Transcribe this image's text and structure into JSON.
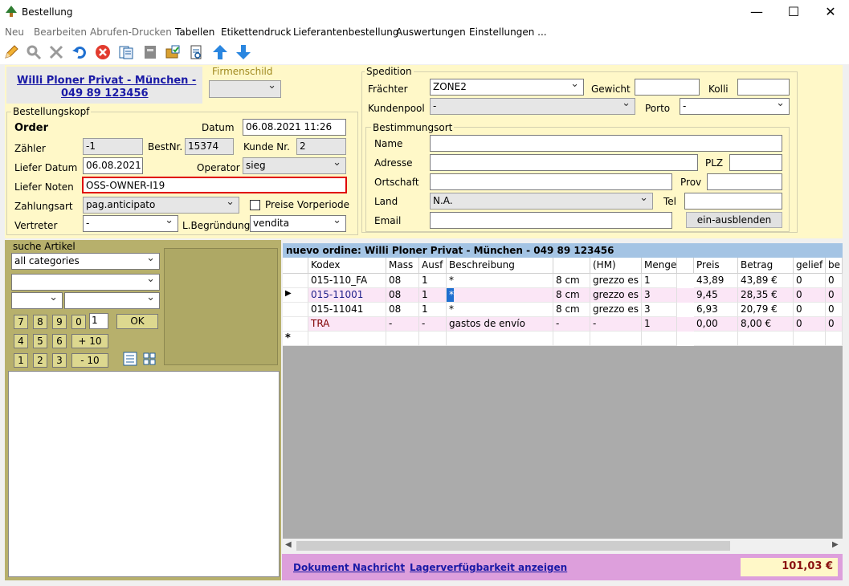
{
  "window": {
    "title": "Bestellung",
    "minimize": "—",
    "maximize": "☐",
    "close": "✕"
  },
  "menu": [
    "Neu",
    "Bearbeiten",
    "Abrufen-Drucken",
    "Tabellen",
    "Etikettendruck",
    "Lieferantenbestellung",
    "Auswertungen",
    "Einstellungen ..."
  ],
  "customer": {
    "name": "Willi Ploner Privat - München -",
    "phone": "049 89 123456"
  },
  "firmenschild": {
    "label": "Firmenschild",
    "value": ""
  },
  "head": {
    "group_label": "Bestellungskopf",
    "order_title": "Order",
    "datum_label": "Datum",
    "datum": "06.08.2021 11:26",
    "zaehler_label": "Zähler",
    "zaehler": "-1",
    "bestnr_label": "BestNr.",
    "bestnr": "15374",
    "kunde_label": "Kunde Nr.",
    "kunde": "2",
    "lieferdatum_label": "Liefer Datum",
    "lieferdatum": "06.08.2021",
    "operator_label": "Operator",
    "operator": "sieg",
    "liefernoten_label": "Liefer Noten",
    "liefernoten": "OSS-OWNER-I19",
    "zahlungsart_label": "Zahlungsart",
    "zahlungsart": "pag.anticipato",
    "preise_label": "Preise Vorperiode",
    "vertreter_label": "Vertreter",
    "vertreter": "-",
    "begruendung_label": "L.Begründung",
    "begruendung": "vendita"
  },
  "spedition": {
    "group_label": "Spedition",
    "fraechter_label": "Frächter",
    "fraechter": "ZONE2",
    "gewicht_label": "Gewicht",
    "gewicht": "",
    "kolli_label": "Kolli",
    "kolli": "",
    "kundenpool_label": "Kundenpool",
    "kundenpool": "-",
    "porto_label": "Porto",
    "porto": "-"
  },
  "bestimmung": {
    "group_label": "Bestimmungsort",
    "name_label": "Name",
    "adresse_label": "Adresse",
    "plz_label": "PLZ",
    "ortschaft_label": "Ortschaft",
    "prov_label": "Prov",
    "land_label": "Land",
    "land": "N.A.",
    "tel_label": "Tel",
    "email_label": "Email",
    "toggle_button": "ein-ausblenden"
  },
  "search": {
    "group_label": "suche Artikel",
    "category": "all categories",
    "qty": "1",
    "ok": "OK",
    "plus10": "+ 10",
    "minus10": "- 10",
    "keys": [
      "7",
      "8",
      "9",
      "0",
      "4",
      "5",
      "6",
      "1",
      "2",
      "3"
    ]
  },
  "grid": {
    "title": "nuevo ordine: Willi Ploner Privat - München - 049 89 123456",
    "columns": [
      "Kodex",
      "Mass",
      "Ausf",
      "Beschreibung",
      "",
      "(HM)",
      "Menge",
      "Preis",
      "Betrag",
      "gelief",
      "be"
    ],
    "rows": [
      [
        "015-110_FA",
        "08",
        "1",
        "*",
        "8 cm",
        "grezzo es",
        "1",
        "43,89",
        "43,89 €",
        "0",
        "0"
      ],
      [
        "015-11001",
        "08",
        "1",
        "*",
        "8 cm",
        "grezzo es",
        "3",
        "9,45",
        "28,35 €",
        "0",
        "0"
      ],
      [
        "015-11041",
        "08",
        "1",
        "*",
        "8 cm",
        "grezzo es",
        "3",
        "6,93",
        "20,79 €",
        "0",
        "0"
      ],
      [
        "TRA",
        "-",
        "-",
        "gastos de envío",
        "-",
        "-",
        "1",
        "0,00",
        "8,00 €",
        "0",
        "0"
      ]
    ],
    "new_row_marker": "*",
    "current_marker": "▶"
  },
  "footer": {
    "doc_link": "Dokument Nachricht",
    "stock_link": "Lagerverfügbarkeit anzeigen",
    "total": "101,03 €"
  },
  "colors": {
    "panel": "#fff8c8",
    "olive": "#b7b06c",
    "pink": "#fbe6f6",
    "footer": "#dd9fdc",
    "grid_title": "#a4c4e4",
    "error": "#e00000"
  }
}
